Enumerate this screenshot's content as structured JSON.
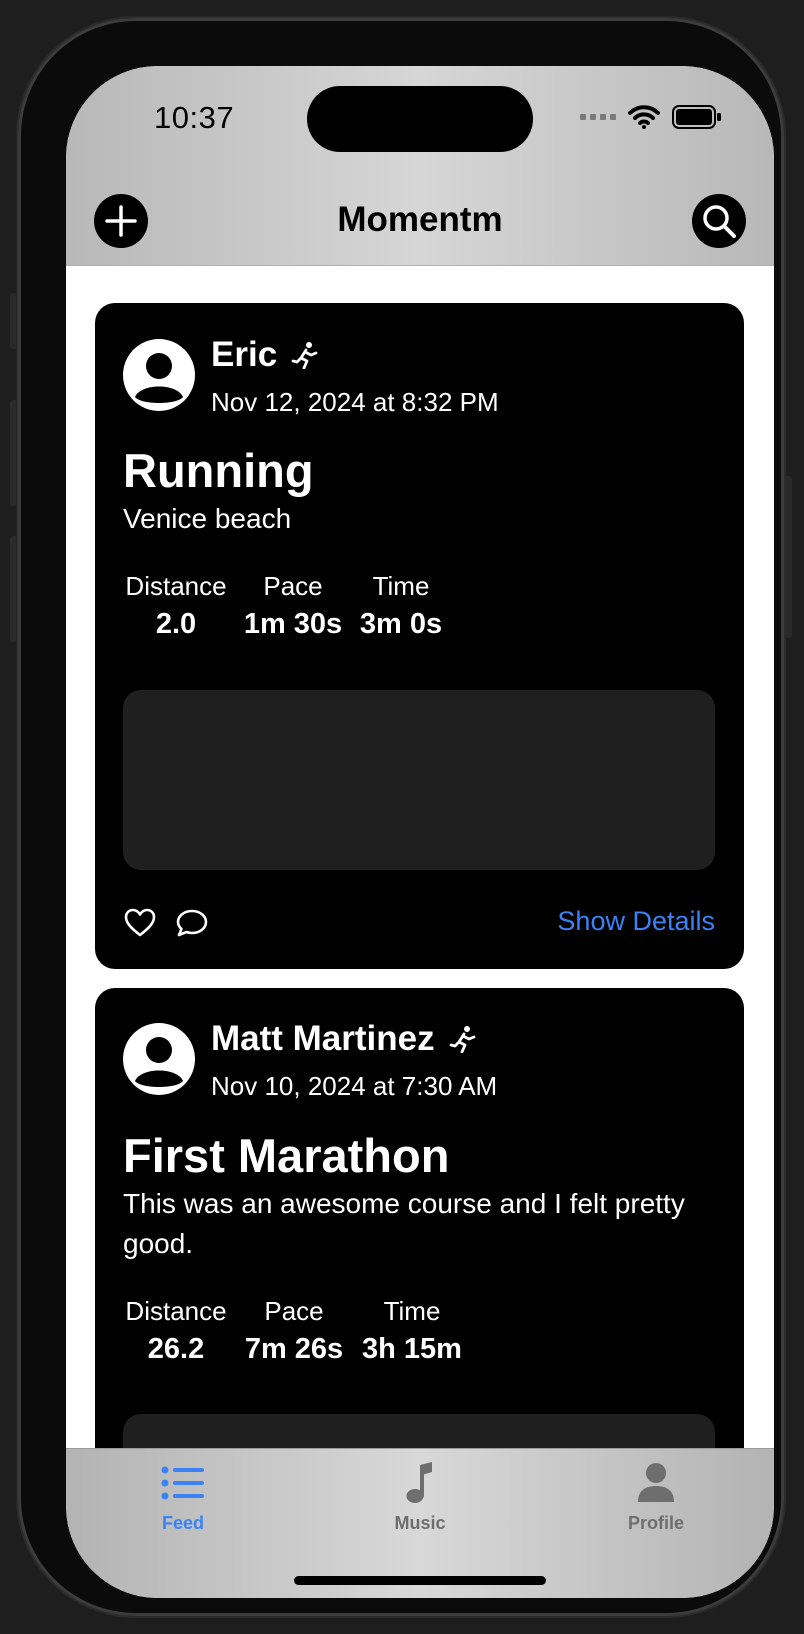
{
  "status_bar": {
    "time": "10:37"
  },
  "nav": {
    "title": "Momentm"
  },
  "posts": [
    {
      "user": "Eric",
      "date": "Nov 12, 2024 at 8:32 PM",
      "title": "Running",
      "description": "Venice beach",
      "stats": [
        {
          "label": "Distance",
          "value": "2.0"
        },
        {
          "label": "Pace",
          "value": "1m 30s"
        },
        {
          "label": "Time",
          "value": "3m 0s"
        }
      ],
      "details_label": "Show Details"
    },
    {
      "user": "Matt Martinez",
      "date": "Nov 10, 2024 at 7:30 AM",
      "title": "First Marathon",
      "description": "This was an awesome course and I felt pretty good.",
      "stats": [
        {
          "label": "Distance",
          "value": "26.2"
        },
        {
          "label": "Pace",
          "value": "7m 26s"
        },
        {
          "label": "Time",
          "value": "3h 15m"
        }
      ]
    }
  ],
  "tabs": [
    {
      "label": "Feed",
      "icon": "list-icon",
      "active": true
    },
    {
      "label": "Music",
      "icon": "music-note-icon",
      "active": false
    },
    {
      "label": "Profile",
      "icon": "person-icon",
      "active": false
    }
  ],
  "colors": {
    "accent": "#3b82f6",
    "card": "#000000",
    "map_placeholder": "#1f1f1f",
    "inactive_tab": "#6e6e6e"
  }
}
